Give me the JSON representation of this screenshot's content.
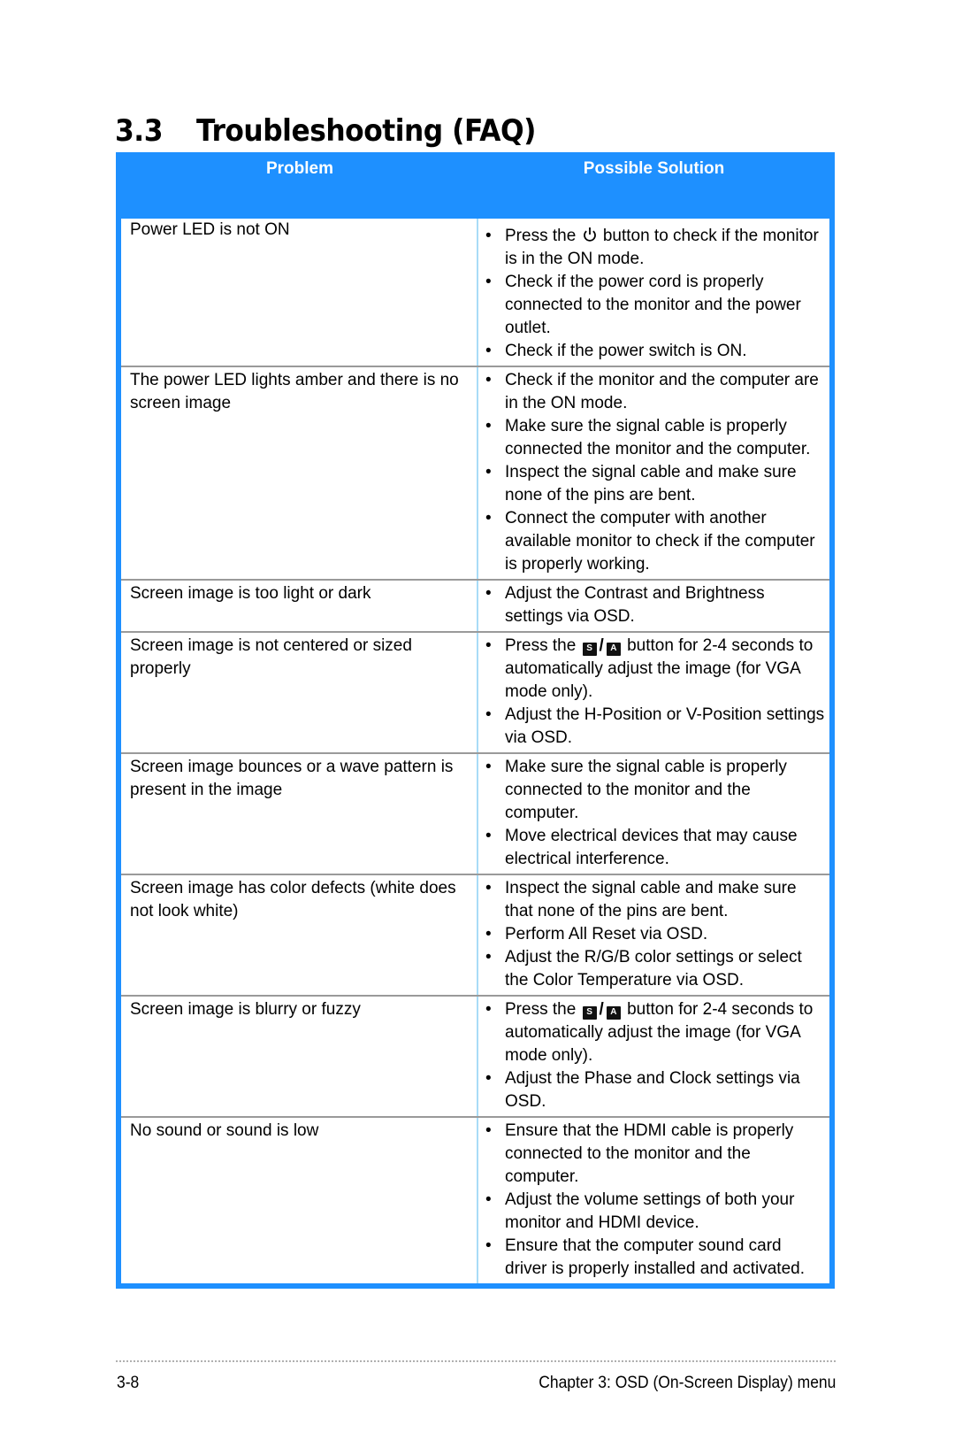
{
  "heading": {
    "number": "3.3",
    "text": "Troubleshooting (FAQ)"
  },
  "colors": {
    "table_accent": "#1e90ff",
    "column_divider": "#a8dcf7",
    "row_divider": "#9a9a9a"
  },
  "table": {
    "headers": {
      "problem": "Problem",
      "solution": "Possible Solution"
    },
    "rows": [
      {
        "problem": "Power  LED is not ON",
        "solutions": [
          {
            "before": "Press the",
            "icon": "power-icon",
            "after": "button to check if the monitor is in the ON mode."
          },
          {
            "text": "Check if the power cord is properly connected to the monitor and the power outlet."
          },
          {
            "text": "Check if the power switch is ON."
          }
        ]
      },
      {
        "problem": "The power LED lights amber and there is no screen image",
        "solutions": [
          {
            "text": "Check if the monitor and the computer are in the ON mode."
          },
          {
            "text": "Make sure the signal cable is properly connected the monitor and the computer."
          },
          {
            "text": "Inspect the signal cable and make sure none of the pins are bent."
          },
          {
            "text": "Connect the computer with another available monitor to check if the computer is properly working."
          }
        ]
      },
      {
        "problem": "Screen image is too light or dark",
        "solutions": [
          {
            "text": "Adjust the Contrast and Brightness settings via OSD."
          }
        ]
      },
      {
        "problem": "Screen image is not centered or sized properly",
        "solutions": [
          {
            "before": "Press the",
            "icon": "s-a-key-icon",
            "key1": "S",
            "key2": "A",
            "after": "button for 2-4 seconds to automatically adjust the image (for VGA mode only)."
          },
          {
            "text": "Adjust the H-Position or V-Position settings via OSD."
          }
        ]
      },
      {
        "problem": "Screen image bounces or a wave pattern is present in the image",
        "solutions": [
          {
            "text": "Make sure the signal cable is properly connected to the monitor and the computer."
          },
          {
            "text": "Move electrical devices that may cause electrical interference."
          }
        ]
      },
      {
        "problem": "Screen image has color defects (white does not look white)",
        "solutions": [
          {
            "text": "Inspect the signal cable and make sure that none of the pins are bent."
          },
          {
            "text": "Perform All Reset via OSD."
          },
          {
            "text": "Adjust the R/G/B color settings or select the Color Temperature via OSD."
          }
        ]
      },
      {
        "problem": "Screen image is blurry or fuzzy",
        "solutions": [
          {
            "before": "Press the",
            "icon": "s-a-key-icon",
            "key1": "S",
            "key2": "A",
            "after": "button for 2-4 seconds to automatically adjust the image (for VGA mode only)."
          },
          {
            "text": "Adjust the Phase and Clock settings via OSD."
          }
        ]
      },
      {
        "problem": "No sound or sound is low",
        "solutions": [
          {
            "text": "Ensure that the HDMI cable is properly connected to the monitor and the computer."
          },
          {
            "text": "Adjust the volume settings of both your monitor and HDMI device."
          },
          {
            "text": "Ensure that the computer sound card driver is properly installed and activated."
          }
        ]
      }
    ]
  },
  "footer": {
    "page_number": "3-8",
    "chapter": "Chapter 3: OSD (On-Screen Display) menu",
    "bullet_glyph": "•",
    "slash": "/"
  }
}
